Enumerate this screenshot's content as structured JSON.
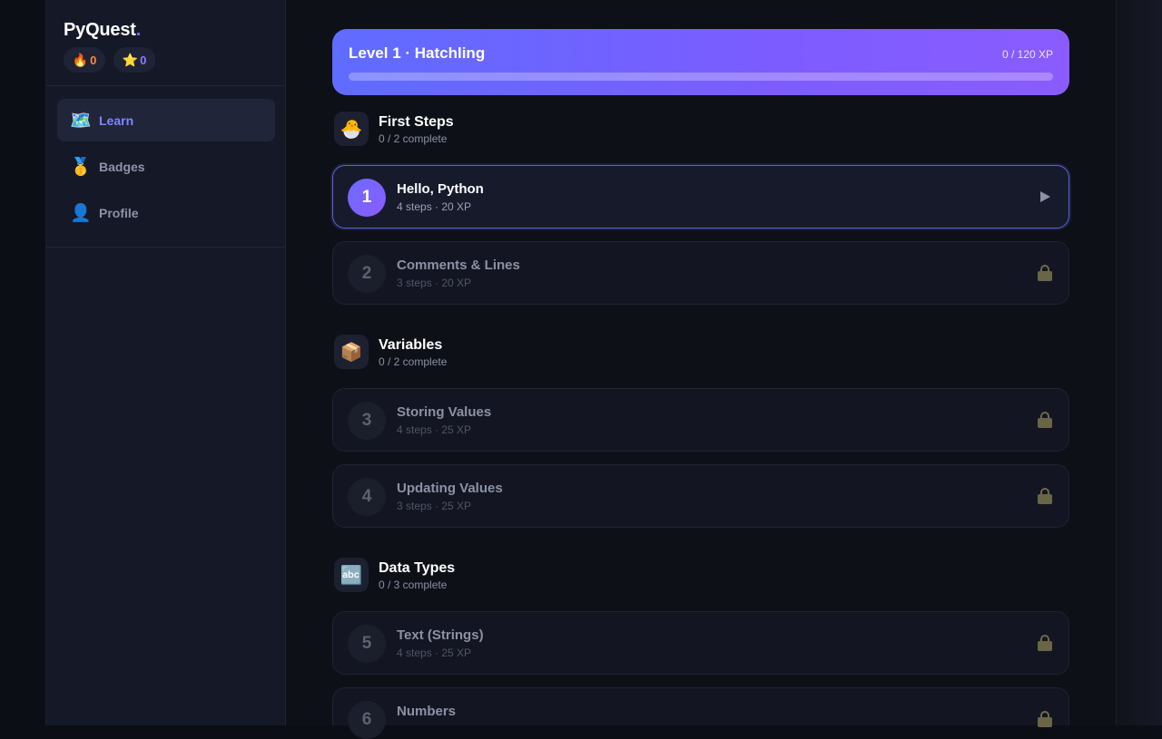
{
  "brand": {
    "name": "PyQuest",
    "dot": "."
  },
  "stats": {
    "streak_icon": "fire-icon",
    "streak": "0",
    "stars_icon": "star-icon",
    "stars": "0"
  },
  "nav": {
    "items": [
      {
        "id": "learn",
        "label": "Learn",
        "icon": "map-icon",
        "active": true
      },
      {
        "id": "badges",
        "label": "Badges",
        "icon": "medal-icon",
        "active": false
      },
      {
        "id": "profile",
        "label": "Profile",
        "icon": "user-icon",
        "active": false
      }
    ]
  },
  "progress": {
    "title": "Level 1 · Hatchling",
    "xp_text": "0 / 120 XP",
    "xp_fraction": 0
  },
  "sections": [
    {
      "title": "First Steps",
      "subtitle": "0 / 2 complete",
      "icon": "hatching-chick-icon",
      "lessons": [
        {
          "number": "1",
          "title": "Hello, Python",
          "meta": "4 steps · 20 XP",
          "state": "active"
        },
        {
          "number": "2",
          "title": "Comments & Lines",
          "meta": "3 steps · 20 XP",
          "state": "locked"
        }
      ]
    },
    {
      "title": "Variables",
      "subtitle": "0 / 2 complete",
      "icon": "package-icon",
      "lessons": [
        {
          "number": "3",
          "title": "Storing Values",
          "meta": "4 steps · 25 XP",
          "state": "locked"
        },
        {
          "number": "4",
          "title": "Updating Values",
          "meta": "3 steps · 25 XP",
          "state": "locked"
        }
      ]
    },
    {
      "title": "Data Types",
      "subtitle": "0 / 3 complete",
      "icon": "abc-icon",
      "lessons": [
        {
          "number": "5",
          "title": "Text (Strings)",
          "meta": "4 steps · 25 XP",
          "state": "locked"
        },
        {
          "number": "6",
          "title": "Numbers",
          "meta": "",
          "state": "locked"
        }
      ]
    }
  ],
  "colors": {
    "accent": "#7c5cff",
    "streak": "#ff8a3d",
    "stars": "#8b7cff",
    "active_nav": "#7f86ff"
  }
}
